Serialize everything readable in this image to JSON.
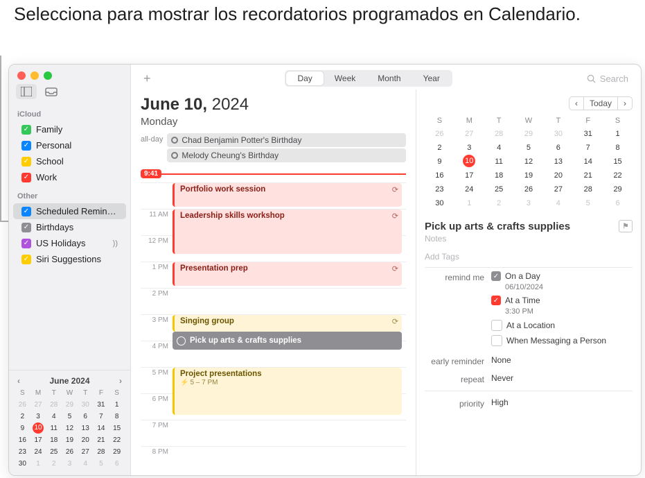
{
  "annotation": "Selecciona para mostrar los recordatorios programados en Calendario.",
  "sidebar": {
    "section1": "iCloud",
    "section2": "Other",
    "items": [
      {
        "label": "Family",
        "color": "#34c759"
      },
      {
        "label": "Personal",
        "color": "#0a84ff"
      },
      {
        "label": "School",
        "color": "#ffcc00"
      },
      {
        "label": "Work",
        "color": "#ff3b30"
      }
    ],
    "other": [
      {
        "label": "Scheduled Remin…",
        "color": "#0a84ff"
      },
      {
        "label": "Birthdays",
        "color": "#8e8e93"
      },
      {
        "label": "US Holidays",
        "color": "#af52de",
        "shared": true
      },
      {
        "label": "Siri Suggestions",
        "color": "#ffcc00"
      }
    ]
  },
  "miniCal": {
    "title": "June 2024",
    "dow": [
      "S",
      "M",
      "T",
      "W",
      "T",
      "F",
      "S"
    ],
    "rows": [
      [
        "26",
        "27",
        "28",
        "29",
        "30",
        "31",
        "1"
      ],
      [
        "2",
        "3",
        "4",
        "5",
        "6",
        "7",
        "8"
      ],
      [
        "9",
        "10",
        "11",
        "12",
        "13",
        "14",
        "15"
      ],
      [
        "16",
        "17",
        "18",
        "19",
        "20",
        "21",
        "22"
      ],
      [
        "23",
        "24",
        "25",
        "26",
        "27",
        "28",
        "29"
      ],
      [
        "30",
        "1",
        "2",
        "3",
        "4",
        "5",
        "6"
      ]
    ],
    "offStart": 5,
    "offEnd": 6,
    "today": "10"
  },
  "topbar": {
    "views": [
      "Day",
      "Week",
      "Month",
      "Year"
    ],
    "active": "Day",
    "searchPlaceholder": "Search"
  },
  "day": {
    "dateBold": "June 10,",
    "dateRest": " 2024",
    "weekday": "Monday",
    "alldayLabel": "all-day",
    "allday": [
      "Chad Benjamin Potter's Birthday",
      "Melody Cheung's Birthday"
    ],
    "nowTime": "9:41",
    "hours": [
      "",
      "11 AM",
      "12 PM",
      "1 PM",
      "2 PM",
      "3 PM",
      "4 PM",
      "5 PM",
      "6 PM",
      "7 PM",
      "8 PM"
    ],
    "events": {
      "e1": {
        "title": "Portfolio work session"
      },
      "e2": {
        "title": "Leadership skills workshop"
      },
      "e3": {
        "title": "Presentation prep"
      },
      "e4": {
        "title": "Singing group"
      },
      "e5": {
        "title": "Pick up arts & crafts supplies"
      },
      "e6": {
        "title": "Project presentations",
        "sub": "5 – 7 PM"
      }
    }
  },
  "inspector": {
    "today": "Today",
    "dow": [
      "S",
      "M",
      "T",
      "W",
      "T",
      "F",
      "S"
    ],
    "rows": [
      [
        "26",
        "27",
        "28",
        "29",
        "30",
        "31",
        "1"
      ],
      [
        "2",
        "3",
        "4",
        "5",
        "6",
        "7",
        "8"
      ],
      [
        "9",
        "10",
        "11",
        "12",
        "13",
        "14",
        "15"
      ],
      [
        "16",
        "17",
        "18",
        "19",
        "20",
        "21",
        "22"
      ],
      [
        "23",
        "24",
        "25",
        "26",
        "27",
        "28",
        "29"
      ],
      [
        "30",
        "1",
        "2",
        "3",
        "4",
        "5",
        "6"
      ]
    ],
    "offStart": 5,
    "offEnd": 6,
    "today_d": "10",
    "title": "Pick up arts & crafts supplies",
    "notes": "Notes",
    "tags": "Add Tags",
    "remindLabel": "remind me",
    "onDay": "On a Day",
    "onDayDate": "06/10/2024",
    "atTime": "At a Time",
    "atTimeVal": "3:30 PM",
    "atLocation": "At a Location",
    "whenMsg": "When Messaging a Person",
    "earlyLabel": "early reminder",
    "earlyVal": "None",
    "repeatLabel": "repeat",
    "repeatVal": "Never",
    "priorityLabel": "priority",
    "priorityVal": "High"
  }
}
